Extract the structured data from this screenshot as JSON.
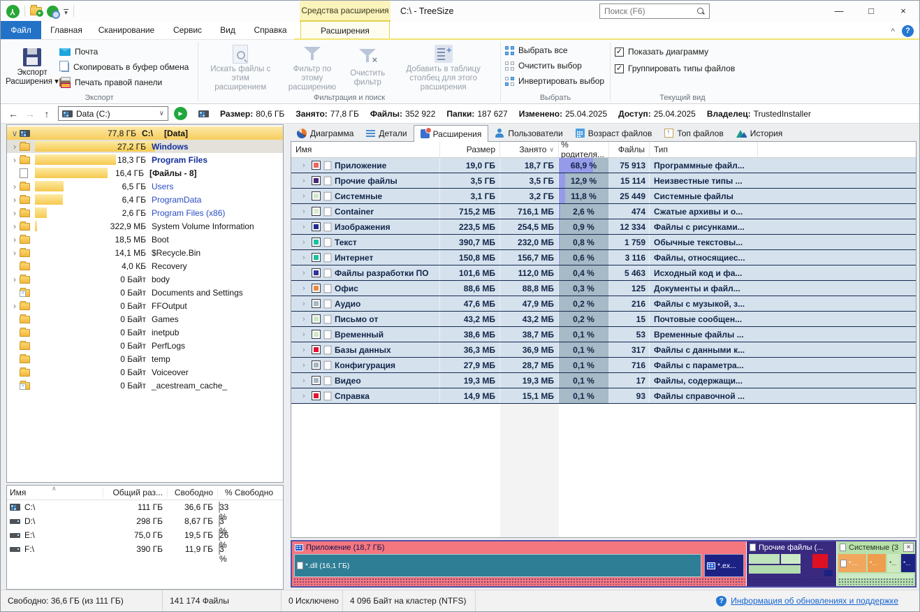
{
  "window": {
    "title": "C:\\ - TreeSize",
    "context_header": "Средства расширения",
    "search_placeholder": "Поиск (F6)"
  },
  "icons": {
    "back": "←",
    "forward": "→",
    "up": "↑",
    "dropdown": "▾",
    "combo_dropdown": "∨",
    "sort_desc": "∨",
    "expander_open": "∨",
    "play": "▶",
    "check": "✓",
    "minimize": "—",
    "maximize": "□",
    "close": "×",
    "collapse": "^",
    "help": "?",
    "clear_x": "×",
    "asc": "∧"
  },
  "menu": {
    "tabs": [
      "Файл",
      "Главная",
      "Сканирование",
      "Сервис",
      "Вид",
      "Справка",
      "Расширения"
    ]
  },
  "ribbon": {
    "export": {
      "group": "Экспорт",
      "big_line1": "Экспорт",
      "big_line2": "Расширения",
      "items": [
        "Почта",
        "Скопировать в буфер обмена",
        "Печать правой панели"
      ]
    },
    "filter": {
      "group": "Фильтрация и поиск",
      "items": [
        "Искать файлы с этим расширением",
        "Фильтр по этому расширению",
        "Очистить фильтр",
        "Добавить в таблицу столбец для этого расширения"
      ]
    },
    "select": {
      "group": "Выбрать",
      "items": [
        "Выбрать все",
        "Очистить выбор",
        "Инвертировать выбор"
      ]
    },
    "view": {
      "group": "Текущий вид",
      "items": [
        "Показать диаграмму",
        "Группировать типы файлов"
      ]
    }
  },
  "address": {
    "value": "Data (C:)"
  },
  "info": [
    {
      "label": "Размер:",
      "value": "80,6 ГБ"
    },
    {
      "label": "Занято:",
      "value": "77,8 ГБ"
    },
    {
      "label": "Файлы:",
      "value": "352 922"
    },
    {
      "label": "Папки:",
      "value": "187 627"
    },
    {
      "label": "Изменено:",
      "value": "25.04.2025"
    },
    {
      "label": "Доступ:",
      "value": "25.04.2025"
    },
    {
      "label": "Владелец:",
      "value": "TrustedInstaller"
    }
  ],
  "tree": {
    "root": {
      "size": "77,8 ГБ",
      "path": "C:\\",
      "name": "[Data]"
    },
    "items": [
      {
        "exp": "›",
        "icon": "folder",
        "size": "27,2 ГБ",
        "name": "Windows",
        "bar": "172px",
        "color": "#15309c",
        "bold": "700"
      },
      {
        "exp": "›",
        "icon": "folder",
        "size": "18,3 ГБ",
        "name": "Program Files",
        "bar": "116px",
        "color": "#15309c",
        "bold": "700"
      },
      {
        "exp": "",
        "icon": "file",
        "size": "16,4 ГБ",
        "name": "[Файлы - 8]",
        "bar": "104px",
        "color": "#141414",
        "bold": "700"
      },
      {
        "exp": "›",
        "icon": "folder",
        "size": "6,5 ГБ",
        "name": "Users",
        "bar": "41px",
        "color": "#2a4cc4",
        "bold": "400"
      },
      {
        "exp": "›",
        "icon": "folder",
        "size": "6,4 ГБ",
        "name": "ProgramData",
        "bar": "40px",
        "color": "#2a4cc4",
        "bold": "400"
      },
      {
        "exp": "›",
        "icon": "folder",
        "size": "2,6 ГБ",
        "name": "Program Files (x86)",
        "bar": "17px",
        "color": "#2a4cc4",
        "bold": "400"
      },
      {
        "exp": "›",
        "icon": "folder",
        "size": "322,9 МБ",
        "name": "System Volume Information",
        "bar": "3px",
        "color": "#141414",
        "bold": "400"
      },
      {
        "exp": "›",
        "icon": "folder",
        "size": "18,5 МБ",
        "name": "Boot",
        "bar": "0px",
        "color": "#141414",
        "bold": "400"
      },
      {
        "exp": "›",
        "icon": "folder",
        "size": "14,1 МБ",
        "name": "$Recycle.Bin",
        "bar": "0px",
        "color": "#141414",
        "bold": "400"
      },
      {
        "exp": "",
        "icon": "folder",
        "size": "4,0 КБ",
        "name": "Recovery",
        "bar": "0px",
        "color": "#141414",
        "bold": "400"
      },
      {
        "exp": "›",
        "icon": "folder",
        "size": "0 Байт",
        "name": "body",
        "bar": "0px",
        "color": "#141414",
        "bold": "400"
      },
      {
        "exp": "",
        "icon": "folder-link",
        "size": "0 Байт",
        "name": "Documents and Settings",
        "bar": "0px",
        "color": "#141414",
        "bold": "400"
      },
      {
        "exp": "›",
        "icon": "folder",
        "size": "0 Байт",
        "name": "FFOutput",
        "bar": "0px",
        "color": "#141414",
        "bold": "400"
      },
      {
        "exp": "",
        "icon": "folder",
        "size": "0 Байт",
        "name": "Games",
        "bar": "0px",
        "color": "#141414",
        "bold": "400"
      },
      {
        "exp": "",
        "icon": "folder",
        "size": "0 Байт",
        "name": "inetpub",
        "bar": "0px",
        "color": "#141414",
        "bold": "400"
      },
      {
        "exp": "",
        "icon": "folder",
        "size": "0 Байт",
        "name": "PerfLogs",
        "bar": "0px",
        "color": "#141414",
        "bold": "400"
      },
      {
        "exp": "",
        "icon": "folder",
        "size": "0 Байт",
        "name": "temp",
        "bar": "0px",
        "color": "#141414",
        "bold": "400"
      },
      {
        "exp": "",
        "icon": "folder",
        "size": "0 Байт",
        "name": "Voiceover",
        "bar": "0px",
        "color": "#141414",
        "bold": "400"
      },
      {
        "exp": "",
        "icon": "folder-link",
        "size": "0 Байт",
        "name": "_acestream_cache_",
        "bar": "0px",
        "color": "#141414",
        "bold": "400"
      }
    ]
  },
  "drives": {
    "columns": [
      "Имя",
      "Общий раз...",
      "Свободно",
      "% Свободно"
    ],
    "rows": [
      {
        "name": "C:\\",
        "total": "111 ГБ",
        "free": "36,6 ГБ",
        "pct": "33 %",
        "bar": "33%",
        "bar_color": "#22dd22"
      },
      {
        "name": "D:\\",
        "total": "298 ГБ",
        "free": "8,67 ГБ",
        "pct": "3 %",
        "bar": "4%",
        "bar_color": "#e6dc5a"
      },
      {
        "name": "E:\\",
        "total": "75,0 ГБ",
        "free": "19,5 ГБ",
        "pct": "26 %",
        "bar": "26%",
        "bar_color": "#22dd22"
      },
      {
        "name": "F:\\",
        "total": "390 ГБ",
        "free": "11,9 ГБ",
        "pct": "3 %",
        "bar": "4%",
        "bar_color": "#e6dc5a"
      }
    ]
  },
  "view_tabs": [
    "Диаграмма",
    "Детали",
    "Расширения",
    "Пользователи",
    "Возраст файлов",
    "Топ файлов",
    "История"
  ],
  "table": {
    "columns": [
      "Имя",
      "Размер",
      "Занято",
      "% родителя...",
      "Файлы",
      "Тип"
    ],
    "rows": [
      {
        "name": "Приложение",
        "size": "19,0 ГБ",
        "used": "18,7 ГБ",
        "pct": "68,9 %",
        "files": "75 913",
        "type": "Программные файл...",
        "color": "#f0655f",
        "bar": "69%"
      },
      {
        "name": "Прочие файлы",
        "size": "3,5 ГБ",
        "used": "3,5 ГБ",
        "pct": "12,9 %",
        "files": "15 114",
        "type": "Неизвестные типы ...",
        "color": "#43277d",
        "bar": "13%"
      },
      {
        "name": "Системные",
        "size": "3,1 ГБ",
        "used": "3,2 ГБ",
        "pct": "11,8 %",
        "files": "25 449",
        "type": "Системные файлы",
        "color": "#cfe9c8",
        "bar": "12%"
      },
      {
        "name": "Container",
        "size": "715,2 МБ",
        "used": "716,1 МБ",
        "pct": "2,6 %",
        "files": "474",
        "type": "Сжатые архивы и о...",
        "color": "#d8eec9",
        "bar": "3%"
      },
      {
        "name": "Изображения",
        "size": "223,5 МБ",
        "used": "254,5 МБ",
        "pct": "0,9 %",
        "files": "12 334",
        "type": "Файлы с рисунками...",
        "color": "#1c2d8c",
        "bar": "1%"
      },
      {
        "name": "Текст",
        "size": "390,7 МБ",
        "used": "232,0 МБ",
        "pct": "0,8 %",
        "files": "1 759",
        "type": "Обычные текстовы...",
        "color": "#16c2a4",
        "bar": "1%"
      },
      {
        "name": "Интернет",
        "size": "150,8 МБ",
        "used": "156,7 МБ",
        "pct": "0,6 %",
        "files": "3 116",
        "type": "Файлы, относящиес...",
        "color": "#16c2a4",
        "bar": "1%"
      },
      {
        "name": "Файлы разработки ПО",
        "size": "101,6 МБ",
        "used": "112,0 МБ",
        "pct": "0,4 %",
        "files": "5 463",
        "type": "Исходный код и фа...",
        "color": "#30309e",
        "bar": "0%"
      },
      {
        "name": "Офис",
        "size": "88,6 МБ",
        "used": "88,8 МБ",
        "pct": "0,3 %",
        "files": "125",
        "type": "Документы и файл...",
        "color": "#ec8a3c",
        "bar": "0%"
      },
      {
        "name": "Аудио",
        "size": "47,6 МБ",
        "used": "47,9 МБ",
        "pct": "0,2 %",
        "files": "216",
        "type": "Файлы с музыкой, з...",
        "color": "#a3b8c2",
        "bar": "0%"
      },
      {
        "name": "Письмо от",
        "size": "43,2 МБ",
        "used": "43,2 МБ",
        "pct": "0,2 %",
        "files": "15",
        "type": "Почтовые сообщен...",
        "color": "#c8e9c2",
        "bar": "0%"
      },
      {
        "name": "Временный",
        "size": "38,6 МБ",
        "used": "38,7 МБ",
        "pct": "0,1 %",
        "files": "53",
        "type": "Временные файлы ...",
        "color": "#cfe9c4",
        "bar": "0%"
      },
      {
        "name": "Базы данных",
        "size": "36,3 МБ",
        "used": "36,9 МБ",
        "pct": "0,1 %",
        "files": "317",
        "type": "Файлы с данными к...",
        "color": "#e61230",
        "bar": "0%"
      },
      {
        "name": "Конфигурация",
        "size": "27,9 МБ",
        "used": "28,7 МБ",
        "pct": "0,1 %",
        "files": "716",
        "type": "Файлы с параметра...",
        "color": "#a3b8c2",
        "bar": "0%"
      },
      {
        "name": "Видео",
        "size": "19,3 МБ",
        "used": "19,3 МБ",
        "pct": "0,1 %",
        "files": "17",
        "type": "Файлы, содержащи...",
        "color": "#a3b8c2",
        "bar": "0%"
      },
      {
        "name": "Справка",
        "size": "14,9 МБ",
        "used": "15,1 МБ",
        "pct": "0,1 %",
        "files": "93",
        "type": "Файлы справочной ...",
        "color": "#e61230",
        "bar": "0%"
      }
    ]
  },
  "treemap": {
    "groups": [
      {
        "label": "Приложение (18,7 ГБ)",
        "color": "#f4767e",
        "text_color": "#141452",
        "items": [
          {
            "label": "*.dll (16,1 ГБ)",
            "color": "#2e7e96",
            "text_color": "#ffffff"
          },
          {
            "label": "*.ex...",
            "color": "#1c2184",
            "text_color": "#ffffff"
          }
        ]
      },
      {
        "label": "Прочие файлы (...",
        "color": "#392a80",
        "text_color": "#ffffff",
        "blocks": [
          "#bfe3bb",
          "#cdeac6",
          "#df1022",
          "#b2dcae",
          "#1b2180"
        ]
      },
      {
        "label": "Системные (3",
        "color": "#b7e0ab",
        "text_color": "#27331f",
        "strip_color": "#cdeac6",
        "items": [
          {
            "label": "*....",
            "color": "#f1a75e",
            "text_color": "#ffffff"
          },
          {
            "label": "*...",
            "color": "#ef9d4e",
            "text_color": "#ffffff"
          },
          {
            "label": "*...",
            "color": "#cde9c0",
            "text_color": "#2a3a22"
          },
          {
            "label": "*...",
            "color": "#1b2180",
            "text_color": "#ffffff"
          }
        ]
      }
    ]
  },
  "status": {
    "segments": [
      "Свободно: 36,6 ГБ  (из 111 ГБ)",
      "141 174 Файлы",
      "0 Исключено",
      "4 096 Байт на кластер (NTFS)"
    ],
    "link": "Информация об обновлениях и поддержке"
  }
}
